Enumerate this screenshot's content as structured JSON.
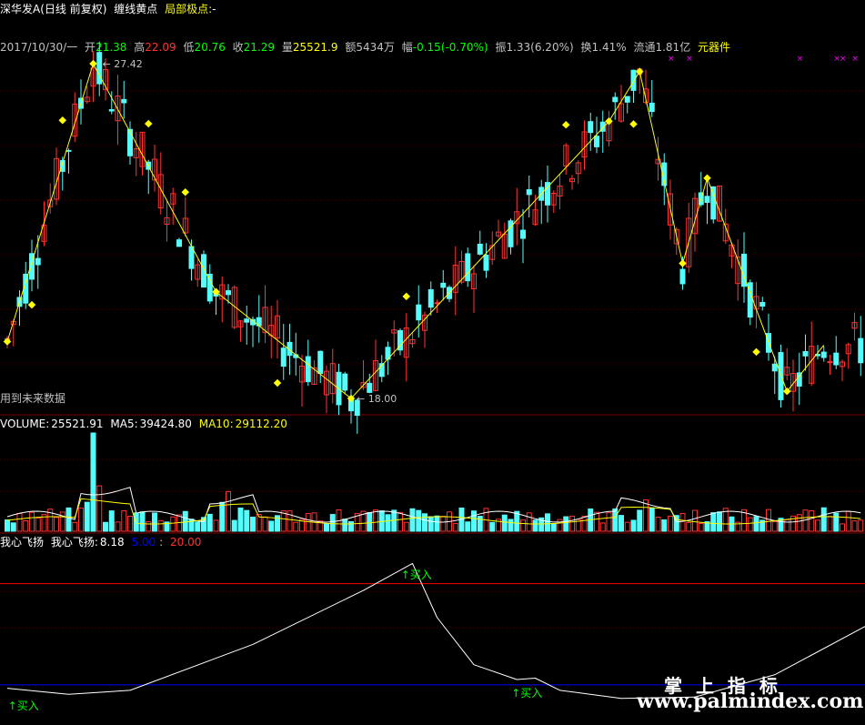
{
  "header": {
    "stock_name": "深华发A",
    "mode": "(日线 前复权)",
    "indicator1": "缠线黄点",
    "indicator2": "局部极点:",
    "indicator2_value": "-"
  },
  "quote": {
    "date": "2017/10/30/一",
    "open_label": "开",
    "open": "21.38",
    "high_label": "高",
    "high": "22.09",
    "low_label": "低",
    "low": "20.76",
    "close_label": "收",
    "close": "21.29",
    "vol_label": "量",
    "vol": "25521.9",
    "amount_label": "额",
    "amount": "5434万",
    "chg_label": "幅",
    "chg": "-0.15(-0.70%)",
    "amp_label": "振",
    "amp": "1.33(6.20%)",
    "turn_label": "换",
    "turn": "1.41%",
    "float_label": "流通",
    "float": "1.81亿",
    "extra": "元器件"
  },
  "price_panel": {
    "max_label": "27.42",
    "min_label": "18.00",
    "future_note": "用到未来数据"
  },
  "volume_panel": {
    "name": "VOLUME:",
    "value": "25521.91",
    "ma5_label": "MA5:",
    "ma5": "39424.80",
    "ma10_label": "MA10:",
    "ma10": "29112.20"
  },
  "osc_panel": {
    "name": "我心飞扬",
    "name2": "我心飞扬:",
    "value": "8.18",
    "low_line": "5.00",
    "high_line": "20.00",
    "signal_label": "买入"
  },
  "watermark": {
    "cn": "掌 上 指 标",
    "url": "www.palmindex.com"
  },
  "colors": {
    "up": "#ff3232",
    "down": "#54fcfc",
    "zigzag": "#ffff00",
    "line_low": "#0000ff",
    "line_high": "#ff0000",
    "osc": "#ffffff",
    "signal": "#00ff00",
    "marker": "#ff00ff"
  },
  "chart_data": {
    "type": "candlestick",
    "zigzag": [
      {
        "i": 0,
        "v": 19.6
      },
      {
        "i": 14,
        "v": 27.42
      },
      {
        "i": 34,
        "v": 21.0
      },
      {
        "i": 56,
        "v": 18.0
      },
      {
        "i": 98,
        "v": 25.8
      },
      {
        "i": 103,
        "v": 27.2
      },
      {
        "i": 110,
        "v": 21.8
      },
      {
        "i": 114,
        "v": 24.2
      },
      {
        "i": 127,
        "v": 18.2
      },
      {
        "i": 133,
        "v": 19.5
      }
    ],
    "yellow_dots": [
      0,
      4,
      9,
      14,
      23,
      29,
      34,
      44,
      56,
      65,
      91,
      98,
      102,
      103,
      110,
      114,
      122,
      127
    ],
    "osc_signals": [
      1,
      65,
      83
    ],
    "osc_levels": [
      5,
      20
    ]
  }
}
